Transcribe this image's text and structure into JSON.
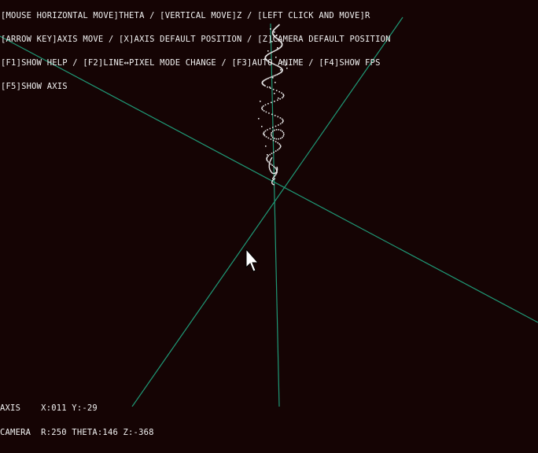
{
  "help_text": {
    "line1": "[MOUSE HORIZONTAL MOVE]THETA / [VERTICAL MOVE]Z / [LEFT CLICK AND MOVE]R",
    "line2": "[ARROW KEY]AXIS MOVE / [X]AXIS DEFAULT POSITION / [Z]CAMERA DEFAULT POSITION",
    "line3": "[F1]SHOW HELP / [F2]LINE↔PIXEL MODE CHANGE / [F3]AUTO ANIME / [F4]SHOW FPS",
    "line4": "[F5]SHOW AXIS"
  },
  "status": {
    "axis_line": "AXIS    X:011 Y:-29",
    "camera_line": "CAMERA  R:250 THETA:146 Z:-368"
  },
  "colors": {
    "background": "#150404",
    "axis_lines": "#1f9a77",
    "points": "#e8e8e8",
    "text": "#f2f2f2"
  },
  "icons": {
    "cursor": "arrow-cursor-icon"
  }
}
